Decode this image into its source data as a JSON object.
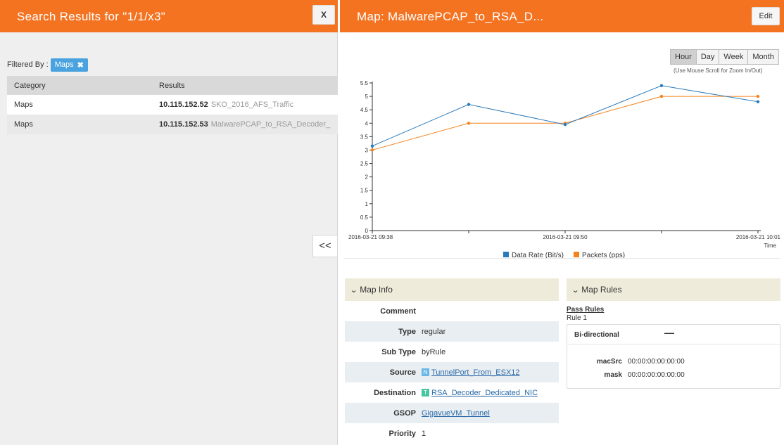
{
  "search_panel": {
    "title": "Search Results for \"1/1/x3\"",
    "close_label": "X",
    "filter_label": "Filtered By :",
    "filter_tag": "Maps",
    "filter_remove": "✖",
    "columns": [
      "Category",
      "Results"
    ],
    "rows": [
      {
        "category": "Maps",
        "ip": "10.115.152.52",
        "name": "SKO_2016_AFS_Traffic"
      },
      {
        "category": "Maps",
        "ip": "10.115.152.53",
        "name": "MalwarePCAP_to_RSA_Decoder_"
      }
    ],
    "collapse_label": "<<"
  },
  "map_panel": {
    "title": "Map: MalwarePCAP_to_RSA_D...",
    "edit_label": "Edit",
    "time_ranges": [
      "Hour",
      "Day",
      "Week",
      "Month"
    ],
    "active_range": "Hour",
    "zoom_hint": "(Use Mouse Scroll for Zoom In/Out)"
  },
  "chart_data": {
    "type": "line",
    "title": "",
    "xlabel": "Time",
    "ylabel": "",
    "ylim": [
      0,
      5.5
    ],
    "y_ticks": [
      "0",
      "0.5",
      "1",
      "1.5",
      "2",
      "2.5",
      "3",
      "3.5",
      "4",
      "4.5",
      "5",
      "5.5"
    ],
    "x_tick_labels": [
      "2016-03-21 09:38",
      "2016-03-21 09:50",
      "2016-03-21 10:01"
    ],
    "x_points": 5,
    "grid": false,
    "legend_position": "bottom",
    "series": [
      {
        "name": "Data Rate (Bit/s)",
        "color": "#2b7bba",
        "values": [
          3.15,
          4.7,
          3.95,
          5.4,
          4.8
        ]
      },
      {
        "name": "Packets (pps)",
        "color": "#f5821f",
        "values": [
          3.0,
          4.0,
          4.0,
          5.0,
          5.0
        ]
      }
    ]
  },
  "map_info": {
    "header": "Map Info",
    "rows": [
      {
        "label": "Comment",
        "value": ""
      },
      {
        "label": "Type",
        "value": "regular"
      },
      {
        "label": "Sub Type",
        "value": "byRule"
      },
      {
        "label": "Source",
        "value": "TunnelPort_From_ESX12",
        "badge": "N"
      },
      {
        "label": "Destination",
        "value": "RSA_Decoder_Dedicated_NIC",
        "badge": "T"
      },
      {
        "label": "GSOP",
        "value": "GigavueVM_Tunnel"
      },
      {
        "label": "Priority",
        "value": "1"
      }
    ]
  },
  "map_rules": {
    "header": "Map Rules",
    "pass_rules": "Pass Rules",
    "rule_name": "Rule 1",
    "direction_label": "Bi-directional",
    "direction_value": "—",
    "fields": [
      {
        "key": "macSrc",
        "value": "00:00:00:00:00:00"
      },
      {
        "key": "mask",
        "value": "00:00:00:00:00:00"
      }
    ]
  },
  "colors": {
    "header_orange": "#f47321",
    "filter_tag_blue": "#4aa3df",
    "link_blue": "#2a6aa8",
    "panel_head_beige": "#efebdb"
  }
}
